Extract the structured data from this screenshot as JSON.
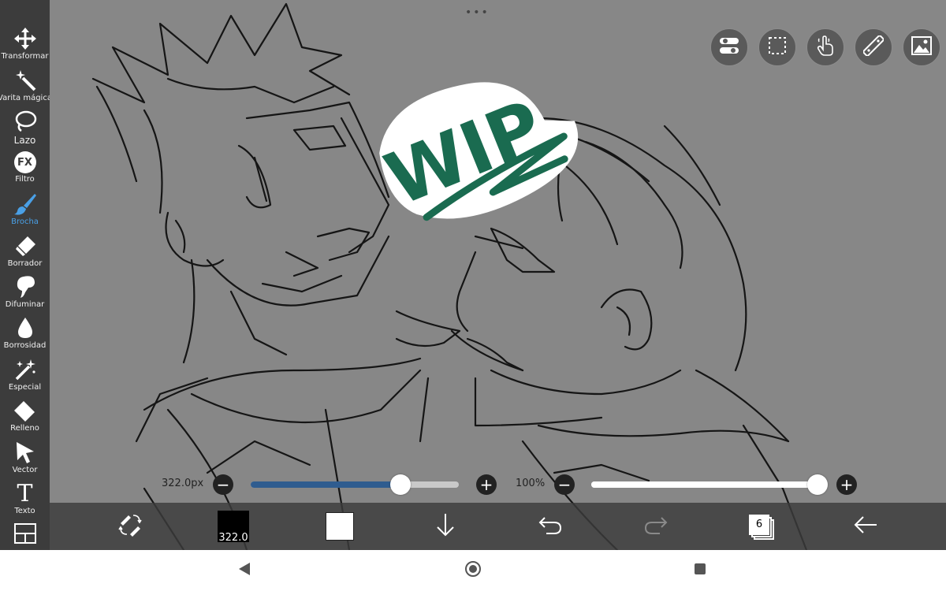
{
  "toolbar": {
    "tools": [
      {
        "label": "Transformar",
        "icon": "move-arrows-icon"
      },
      {
        "label": "Varita mágica",
        "icon": "magic-wand-icon"
      },
      {
        "label": "Lazo",
        "icon": "lasso-icon"
      },
      {
        "label": "Filtro",
        "icon": "fx-icon",
        "icon_text": "FX"
      },
      {
        "label": "Brocha",
        "icon": "brush-icon",
        "active": true
      },
      {
        "label": "Borrador",
        "icon": "eraser-icon"
      },
      {
        "label": "Difuminar",
        "icon": "smudge-icon"
      },
      {
        "label": "Borrosidad",
        "icon": "blur-drop-icon"
      },
      {
        "label": "Especial",
        "icon": "sparkle-wand-icon"
      },
      {
        "label": "Relleno",
        "icon": "fill-bucket-icon"
      },
      {
        "label": "Vector",
        "icon": "cursor-arrow-icon"
      },
      {
        "label": "Texto",
        "icon": "text-icon",
        "icon_text": "T"
      }
    ],
    "more_icon": "frame-divide-icon",
    "active_color": "#4aa0e6"
  },
  "canvas": {
    "background": "#878787",
    "menu_dots": "•••",
    "artwork": "pencil sketch with WIP sticker",
    "wip_text": "WIP",
    "wip_color": "#1a6b50"
  },
  "top_buttons": [
    {
      "name": "toggle-icon"
    },
    {
      "name": "selection-icon"
    },
    {
      "name": "touch-hand-icon"
    },
    {
      "name": "ruler-icon"
    },
    {
      "name": "image-material-icon"
    }
  ],
  "size_slider": {
    "label": "322.0px",
    "fraction": 0.72,
    "fill_color": "#2f5c8f"
  },
  "opacity_slider": {
    "label": "100%",
    "fraction": 1.0
  },
  "bottombar": {
    "brush_size_text": "322.0",
    "layers_count": "6",
    "icons": [
      "swap-pen-eraser-icon",
      "brush-preview-icon",
      "color-swatch-icon",
      "download-arrow-icon",
      "undo-icon",
      "redo-icon",
      "layers-icon",
      "back-arrow-icon"
    ]
  },
  "navbar": {
    "icons": [
      "nav-back-icon",
      "nav-home-icon",
      "nav-recents-icon"
    ]
  }
}
